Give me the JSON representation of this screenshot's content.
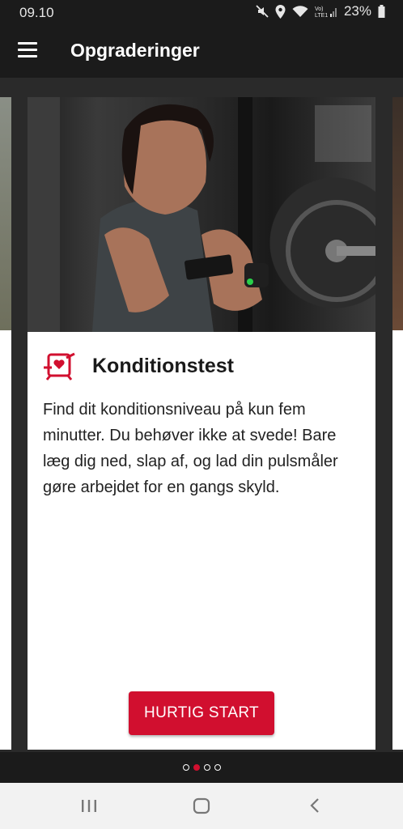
{
  "status": {
    "time": "09.10",
    "battery": "23%"
  },
  "appbar": {
    "title": "Opgraderinger"
  },
  "card": {
    "title": "Konditionstest",
    "description": "Find dit konditionsniveau på kun fem minutter. Du behøver ikke at svede! Bare læg dig ned, slap af, og lad din pulsmåler gøre arbejdet for en gangs skyld.",
    "button": "HURTIG START"
  },
  "pager": {
    "count": 4,
    "active_index": 1
  },
  "colors": {
    "accent": "#d10f2f",
    "bar": "#1b1b1b"
  },
  "icons": [
    "menu-icon",
    "mute-icon",
    "location-icon",
    "wifi-icon",
    "signal-icon",
    "battery-icon",
    "fitness-test-icon",
    "recents-icon",
    "home-icon",
    "back-icon"
  ]
}
